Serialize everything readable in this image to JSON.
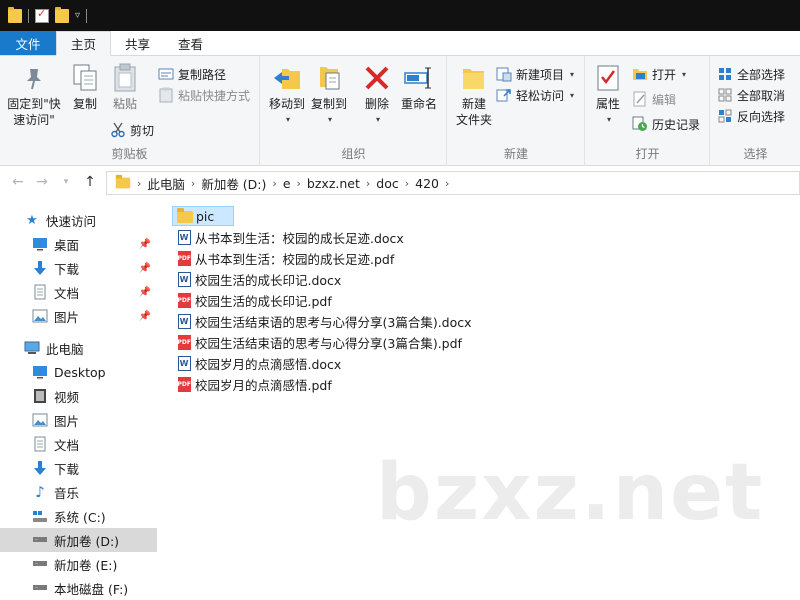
{
  "quick_access_toolbar": {
    "icons": [
      "folder-icon",
      "properties-check-icon",
      "new-folder-icon",
      "customize-caret-icon"
    ]
  },
  "tabs": [
    {
      "label": "文件",
      "kind": "file"
    },
    {
      "label": "主页",
      "active": true
    },
    {
      "label": "共享"
    },
    {
      "label": "查看"
    }
  ],
  "ribbon": {
    "clipboard": {
      "label": "剪贴板",
      "pin_quick_access": "固定到\"快速访问\"",
      "copy": "复制",
      "paste": "粘贴",
      "copy_path": "复制路径",
      "paste_shortcut": "粘贴快捷方式",
      "cut": "剪切"
    },
    "organize": {
      "label": "组织",
      "move_to": "移动到",
      "copy_to": "复制到",
      "delete": "删除",
      "rename": "重命名"
    },
    "new": {
      "label": "新建",
      "new_folder": "新建\n文件夹",
      "new_item": "新建项目",
      "easy_access": "轻松访问"
    },
    "open": {
      "label": "打开",
      "properties": "属性",
      "open": "打开",
      "edit": "编辑",
      "history": "历史记录"
    },
    "select": {
      "label": "选择",
      "select_all": "全部选择",
      "select_none": "全部取消",
      "invert": "反向选择"
    }
  },
  "breadcrumb": [
    "此电脑",
    "新加卷 (D:)",
    "e",
    "bzxz.net",
    "doc",
    "420"
  ],
  "sidebar": {
    "quick_access": "快速访问",
    "quick_items": [
      {
        "label": "桌面",
        "icon": "desktop-icon"
      },
      {
        "label": "下载",
        "icon": "download-icon"
      },
      {
        "label": "文档",
        "icon": "documents-icon"
      },
      {
        "label": "图片",
        "icon": "pictures-icon"
      }
    ],
    "this_pc": "此电脑",
    "pc_items": [
      {
        "label": "Desktop",
        "icon": "desktop-icon"
      },
      {
        "label": "视频",
        "icon": "videos-icon"
      },
      {
        "label": "图片",
        "icon": "pictures-icon"
      },
      {
        "label": "文档",
        "icon": "documents-icon"
      },
      {
        "label": "下载",
        "icon": "download-icon"
      },
      {
        "label": "音乐",
        "icon": "music-icon"
      },
      {
        "label": "系统 (C:)",
        "icon": "system-drive-icon"
      },
      {
        "label": "新加卷 (D:)",
        "icon": "drive-icon",
        "selected": true
      },
      {
        "label": "新加卷 (E:)",
        "icon": "drive-icon"
      },
      {
        "label": "本地磁盘 (F:)",
        "icon": "drive-icon"
      }
    ]
  },
  "files": [
    {
      "name": "pic",
      "type": "folder",
      "selected": true
    },
    {
      "name": "从书本到生活：校园的成长足迹.docx",
      "type": "docx"
    },
    {
      "name": "从书本到生活：校园的成长足迹.pdf",
      "type": "pdf"
    },
    {
      "name": "校园生活的成长印记.docx",
      "type": "docx"
    },
    {
      "name": "校园生活的成长印记.pdf",
      "type": "pdf"
    },
    {
      "name": "校园生活结束语的思考与心得分享(3篇合集).docx",
      "type": "docx"
    },
    {
      "name": "校园生活结束语的思考与心得分享(3篇合集).pdf",
      "type": "pdf"
    },
    {
      "name": "校园岁月的点滴感悟.docx",
      "type": "docx"
    },
    {
      "name": "校园岁月的点滴感悟.pdf",
      "type": "pdf"
    }
  ],
  "watermark": "bzxz.net",
  "colors": {
    "file_tab": "#1979ca",
    "selection": "#cce8ff",
    "title_bar": "#111111"
  }
}
